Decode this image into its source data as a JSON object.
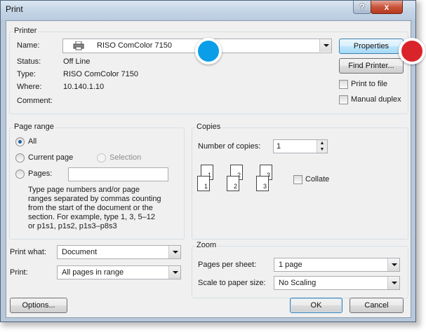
{
  "window": {
    "title": "Print",
    "help_symbol": "?",
    "close_symbol": "x"
  },
  "printer": {
    "group_label": "Printer",
    "name_label": "Name:",
    "name_value": "RISO ComColor 7150",
    "status_label": "Status:",
    "status_value": "Off Line",
    "type_label": "Type:",
    "type_value": "RISO ComColor 7150",
    "where_label": "Where:",
    "where_value": "10.140.1.10",
    "comment_label": "Comment:",
    "properties_button": "Properties",
    "find_printer_button": "Find Printer...",
    "print_to_file_label": "Print to file",
    "manual_duplex_label": "Manual duplex"
  },
  "page_range": {
    "group_label": "Page range",
    "all_label": "All",
    "current_page_label": "Current page",
    "selection_label": "Selection",
    "pages_label": "Pages:",
    "pages_value": "",
    "help_line1": "Type page numbers and/or page",
    "help_line2": "ranges separated by commas counting",
    "help_line3": "from the start of the document or the",
    "help_line4": "section. For example, type 1, 3, 5–12",
    "help_line5": "or p1s1, p1s2, p1s3–p8s3"
  },
  "copies": {
    "group_label": "Copies",
    "number_label": "Number of copies:",
    "number_value": "1",
    "collate_label": "Collate",
    "page_digits": [
      "1",
      "1",
      "2",
      "2",
      "3",
      "3"
    ]
  },
  "print_what": {
    "label": "Print what:",
    "value": "Document"
  },
  "print": {
    "label": "Print:",
    "value": "All pages in range"
  },
  "zoom": {
    "group_label": "Zoom",
    "pages_per_sheet_label": "Pages per sheet:",
    "pages_per_sheet_value": "1 page",
    "scale_label": "Scale to paper size:",
    "scale_value": "No Scaling"
  },
  "footer": {
    "options_button": "Options...",
    "ok_button": "OK",
    "cancel_button": "Cancel"
  },
  "markers": {
    "blue_color": "#0a9ee8",
    "red_color": "#d9242b"
  }
}
